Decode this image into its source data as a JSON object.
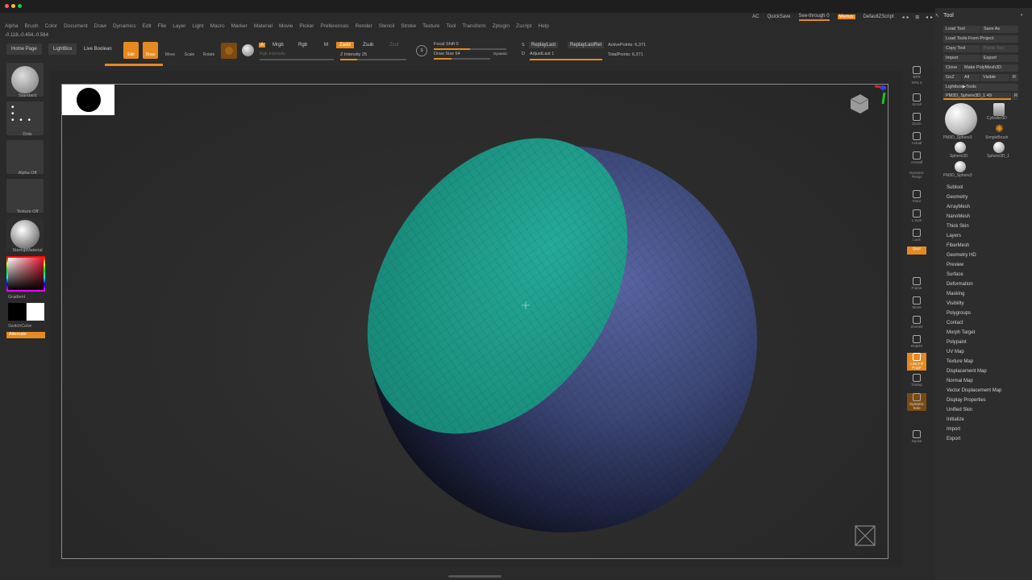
{
  "titlebar": {
    "traffic_lights": [
      "#ff5f57",
      "#febc2e",
      "#28c840"
    ]
  },
  "topright": {
    "ac": "AC",
    "quicksave": "QuickSave",
    "seethrough": "See-through",
    "seethrough_value": "0",
    "menus": "Menus",
    "defaultscript": "DefaultZScript"
  },
  "menubar": [
    "Alpha",
    "Brush",
    "Color",
    "Document",
    "Draw",
    "Dynamics",
    "Edit",
    "File",
    "Layer",
    "Light",
    "Macro",
    "Marker",
    "Material",
    "Movie",
    "Picker",
    "Preferences",
    "Render",
    "Stencil",
    "Stroke",
    "Texture",
    "Tool",
    "Transform",
    "Zplugin",
    "Zscript",
    "Help"
  ],
  "coords": "-0.118,-0.454,-0.564",
  "toolbar": {
    "home_page": "Home Page",
    "lightbox": "LightBox",
    "live_boolean": "Live Boolean",
    "edit": "Edit",
    "draw": "Draw",
    "move": "Move",
    "scale": "Scale",
    "rotate": "Rotate",
    "a": "A",
    "mrgb": "Mrgb",
    "rgb": "Rgb",
    "m": "M",
    "zadd": "Zadd",
    "zsub": "Zsub",
    "zcut": "Zcut",
    "rgb_intensity": "Rgb Intensity",
    "z_intensity": "Z Intensity",
    "z_intensity_value": "25",
    "focal_shift": "Focal Shift",
    "focal_shift_value": "0",
    "draw_size": "Draw Size",
    "draw_size_value": "64",
    "dynamic": "Dynamic",
    "replaylast": "ReplayLast",
    "replaylastrel": "ReplayLastRel",
    "adjustlast": "AdjustLast",
    "adjustlast_value": "1",
    "activepoints": "ActivePoints:",
    "activepoints_value": "6,371",
    "totalpoints": "TotalPoints:",
    "totalpoints_value": "6,371",
    "s_marker": "S",
    "d_marker": "D"
  },
  "leftshelf": {
    "standard": "Standard",
    "dots": "Dots",
    "alpha_off": "Alpha Off",
    "texture_off": "Texture Off",
    "startup_material": "StartupMaterial",
    "gradient": "Gradient",
    "switchcolor": "SwitchColor",
    "alternate": "Alternate"
  },
  "rshelf": [
    "BPR",
    "SPix 3",
    "Scroll",
    "Zoom",
    "Actual",
    "AAHalf",
    "Dynamic Persp",
    "Floor",
    "L.Sym",
    "Lock",
    "Qxyz",
    "Frame",
    "Move",
    "ZoomD",
    "RotaTe",
    "Line Fill PolyF",
    "Transp",
    "Dynamic Solo",
    "Xpose"
  ],
  "rshelf_spix_value": "3",
  "toolpanel": {
    "title": "Tool",
    "load_tool": "Load Tool",
    "save_as": "Save As",
    "load_from_project": "Load Tools From Project",
    "copy_tool": "Copy Tool",
    "paste_tool": "Paste Tool",
    "import": "Import",
    "export": "Export",
    "clone": "Clone",
    "make_polymesh": "Make PolyMesh3D",
    "goz": "GoZ",
    "all": "All",
    "visible": "Visible",
    "r": "R",
    "lightbox_tools": "Lightbox▶Tools",
    "current_tool": "PM3D_Sphere3D_1",
    "current_tool_value": "49",
    "thumbs": [
      "PM3D_Sphere3",
      "Cylinder3D",
      "SimpleBrush",
      "Sphere3D",
      "Sphere3D_1",
      "PM3D_Sphere3"
    ],
    "subpalettes": [
      "Subtool",
      "Geometry",
      "ArrayMesh",
      "NanoMesh",
      "Thick Skin",
      "Layers",
      "FiberMesh",
      "Geometry HD",
      "Preview",
      "Surface",
      "Deformation",
      "Masking",
      "Visibility",
      "Polygroups",
      "Contact",
      "Morph Target",
      "Polypaint",
      "UV Map",
      "Texture Map",
      "Displacement Map",
      "Normal Map",
      "Vector Displacement Map",
      "Display Properties",
      "Unified Skin",
      "Initialize",
      "Import",
      "Export"
    ]
  },
  "colors": {
    "accent": "#e58a1f",
    "mesh_cap": "#1f9b8c",
    "mesh_sphere": "#3b4577"
  }
}
